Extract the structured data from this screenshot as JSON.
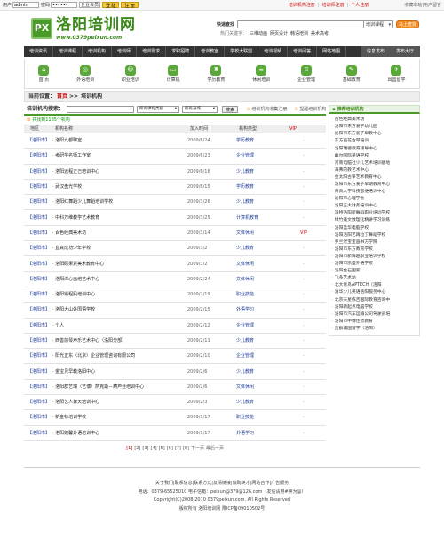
{
  "topbar": {
    "user_label": "用户",
    "user_value": "admin",
    "pass_label": "密码",
    "pass_value": "••••••",
    "role_select": "企业会员",
    "login_btn": "登 陆",
    "register_btn": "注 册",
    "links": [
      "培训机构注册",
      "培训师注册",
      "个人注册"
    ],
    "fav": "收藏本站|用户留言"
  },
  "header": {
    "logo_mark": "PX",
    "logo_name": "洛阳培训网",
    "logo_url": "www.0379peixun.com",
    "search_label": "快速查找",
    "search_placeholder": "",
    "search_category": "培训课程",
    "search_btn": "马上查找",
    "hot_label": "热门关键字：",
    "hot_words": [
      "三维动画",
      "网页设计",
      "韩语培训",
      "美术高考"
    ]
  },
  "nav": {
    "items": [
      "培训资讯",
      "培训课程",
      "培训机构",
      "培训师",
      "培训需求",
      "求职招聘",
      "培训教室",
      "学校大联盟",
      "培训视频",
      "培训问答",
      "网站地图"
    ],
    "right": [
      "信息发布",
      "发布大厅"
    ]
  },
  "icon_nav": [
    {
      "label": "首 页",
      "icon": "home-icon",
      "glyph": "⌂"
    },
    {
      "label": "外语培训",
      "icon": "globe-icon",
      "glyph": "◎"
    },
    {
      "label": "职业培训",
      "icon": "person-icon",
      "glyph": "☺"
    },
    {
      "label": "计算机",
      "icon": "computer-icon",
      "glyph": "▭"
    },
    {
      "label": "学历教育",
      "icon": "graduation-icon",
      "glyph": "♜"
    },
    {
      "label": "休闲培训",
      "icon": "leisure-icon",
      "glyph": "☕"
    },
    {
      "label": "企业管理",
      "icon": "building-icon",
      "glyph": "♖"
    },
    {
      "label": "基础教育",
      "icon": "book-icon",
      "glyph": "✎"
    },
    {
      "label": "出国留学",
      "icon": "plane-icon",
      "glyph": "✈"
    }
  ],
  "breadcrumb": {
    "prefix": "当前位置：",
    "home": "首页",
    "sep": ">>",
    "current": "培训机构"
  },
  "panel": {
    "title": "培训机构搜索：",
    "type_select": "所有课程类别",
    "area_select": "所有县城",
    "search_btn": "搜索",
    "link1": "培训机构收集注册",
    "link2": "提醒培训机构",
    "count_text": "共找到1185个机构"
  },
  "table": {
    "headers": [
      "地区",
      "机构名称",
      "加入时间",
      "机构类型",
      "VIP"
    ],
    "rows": [
      {
        "region": "【洛阳市】",
        "name": "· 洛阳九都聊室",
        "date": "2009/6/24",
        "type": "学历教育",
        "vip": "-"
      },
      {
        "region": "【洛阳市】",
        "name": "· 考研学名师工作室",
        "date": "2009/6/23",
        "type": "企业管理",
        "vip": "-"
      },
      {
        "region": "【洛阳市】",
        "name": "· 洛阳远程正己培训中心",
        "date": "2009/6/16",
        "type": "少儿教育",
        "vip": "-"
      },
      {
        "region": "【洛阳市】",
        "name": "· 武汉盘光学校",
        "date": "2009/6/15",
        "type": "学历教育",
        "vip": "-"
      },
      {
        "region": "【洛阳市】",
        "name": "· 洛阳红舞蹈少儿舞蹈培训学校",
        "date": "2009/3/26",
        "type": "少儿教育",
        "vip": "-"
      },
      {
        "region": "【洛阳市】",
        "name": "· 中科万维教学艺术教育",
        "date": "2009/3/25",
        "type": "计算机教育",
        "vip": "-"
      },
      {
        "region": "【洛阳市】",
        "name": "· 百色经典美术坊",
        "date": "2009/3/14",
        "type": "文体休闲",
        "vip": "VIP"
      },
      {
        "region": "【洛阳市】",
        "name": "· 直真成功少年学校",
        "date": "2009/3/2",
        "type": "少儿教育",
        "vip": "-"
      },
      {
        "region": "【洛阳市】",
        "name": "· 洛阳硕果素美术教育中心",
        "date": "2009/3/2",
        "type": "文体休闲",
        "vip": "-"
      },
      {
        "region": "【洛阳市】",
        "name": "· 洛阳洋心画培艺术中心",
        "date": "2009/2/24",
        "type": "文体休闲",
        "vip": "-"
      },
      {
        "region": "【洛阳市】",
        "name": "· 洛阳锻程股培训中心",
        "date": "2009/2/19",
        "type": "职业技能",
        "vip": "-"
      },
      {
        "region": "【洛阳市】",
        "name": "· 洛阳大山外国语学校",
        "date": "2009/2/15",
        "type": "外语学习",
        "vip": "-"
      },
      {
        "region": "【洛阳市】",
        "name": "· 个人",
        "date": "2009/2/12",
        "type": "企业管理",
        "vip": "-"
      },
      {
        "region": "【洛阳市】",
        "name": "· 西善前琴声乐艺术中心（洛阳分部）",
        "date": "2009/2/11",
        "type": "少儿教育",
        "vip": "-"
      },
      {
        "region": "【洛阳市】",
        "name": "· 阳光正东（北京）企业管理咨询有限公司",
        "date": "2009/2/10",
        "type": "企业管理",
        "vip": "-"
      },
      {
        "region": "【洛阳市】",
        "name": "· 金宝贝早教洛阳中心",
        "date": "2009/2/6",
        "type": "少儿教育",
        "vip": "-"
      },
      {
        "region": "【洛阳市】",
        "name": "· 洛阳群艺瑞（艺博）萨克斯－葫芦丝培训中心",
        "date": "2009/2/6",
        "type": "文体休闲",
        "vip": "-"
      },
      {
        "region": "【洛阳市】",
        "name": "· 洛阳艺人舞天培训中心",
        "date": "2009/2/3",
        "type": "少儿教育",
        "vip": "-"
      },
      {
        "region": "【洛阳市】",
        "name": "· 新金标培训学校",
        "date": "2009/1/17",
        "type": "职业技能",
        "vip": "-"
      },
      {
        "region": "【洛阳市】",
        "name": "· 洛阳婉馨外语培训中心",
        "date": "2009/1/17",
        "type": "外语学习",
        "vip": "-"
      }
    ]
  },
  "pager": {
    "pages": [
      "[1]",
      "[2]",
      "[3]",
      "[4]",
      "[5]",
      "[6]",
      "[7]",
      "[8]"
    ],
    "next": "下一页",
    "last": "最后一页"
  },
  "sidebar": {
    "title": "推荐培训机构",
    "items": [
      "百色经典美术坊",
      "洛阳市东方爱子幼儿园",
      "洛阳市东方爱子早教中心",
      "东方百花古琴培训",
      "洛阳瑞德教育辅导中心",
      "戴尔国际英语学校",
      "河南电脑社少儿艺术培训基地",
      "海弗的教艺术中心",
      "金太阳古筝艺术教育中心",
      "洛阳市东方爱子早期教育中心",
      "菁真人学科技思维培训中心",
      "洛阳市心理学会",
      "洛阳正大财务培训中心",
      "冯特洛阳新舞蹈职业培训学校",
      "绿竹蓬文数理化精讲学习训练",
      "洛阳蓝华电脑学校",
      "洛阳洛阳艺再拉丁舞蹈学校",
      "罗兰老宝宝画书方学院",
      "洛阳市东方教育学校",
      "洛阳市新辉越职业培训学校",
      "洛阳市凯盛外语学校",
      "洛阳金石国家",
      "飞多艺术坊",
      "北大青鸟APTECH（洛阳",
      "清华少儿英语洛阳服务中心",
      "北京天星练吉国际教育咨询中",
      "洛阳新起点电脑学校",
      "洛阳市汽车运输公司驾驶员培",
      "洛阳市中博佳智教育",
      "贾群诚国留学（洛阳）"
    ]
  },
  "footer": {
    "links": [
      "关于我们",
      "联系信息",
      "联系方式",
      "友情链接",
      "诚聘英才",
      "网站合作",
      "广告服务"
    ],
    "contact": "电话：0379-65525010  电子信箱：peixun@379@126.com（发信请用#换为@）",
    "copyright": "Copyright(C)2008-2010 0379peixun.com. All Rights Reserved",
    "owner": "版权所有 洛阳培训网 豫ICP备09010502号"
  }
}
